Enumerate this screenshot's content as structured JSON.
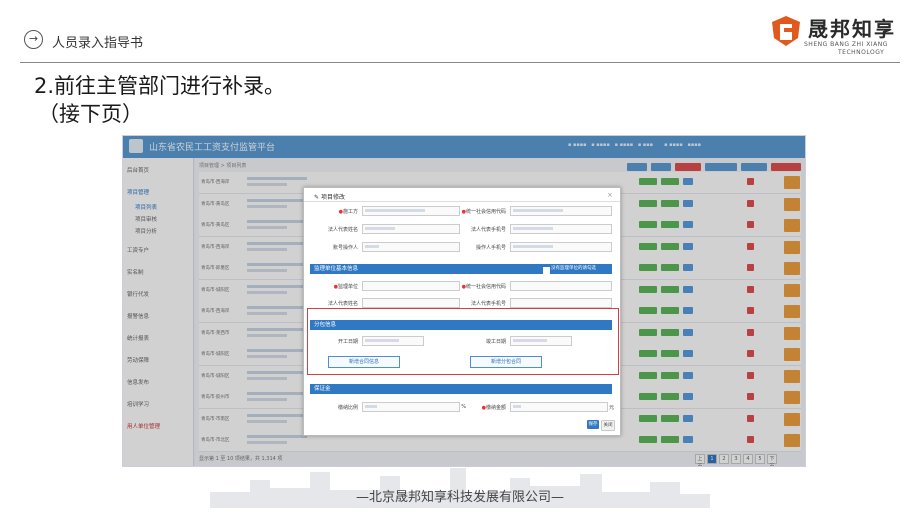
{
  "slide": {
    "header_title": "人员录入指导书",
    "heading": "2.前往主管部门进行补录。",
    "subheading": "（接下页）",
    "footer": "—北京晟邦知享科技发展有限公司—",
    "logo_cn": "晟邦知享",
    "logo_en_1": "SHENG BANG ZHI XIANG",
    "logo_en_2": "TECHNOLOGY"
  },
  "app": {
    "title": "山东省农民工工资支付监管平台",
    "breadcrumb": "项目管理 > 项目列表",
    "pager_text": "显示第 1 至 10 项结果，共 1,314 项",
    "pages": [
      "上页",
      "1",
      "2",
      "3",
      "4",
      "5",
      "下页"
    ]
  },
  "sidebar": {
    "items": [
      {
        "label": "后台首页"
      },
      {
        "label": "项目管理"
      },
      {
        "label": "项目列表"
      },
      {
        "label": "项目审核"
      },
      {
        "label": "项目分析"
      },
      {
        "label": "工资专户"
      },
      {
        "label": "实名制"
      },
      {
        "label": "银行代发"
      },
      {
        "label": "报警信息"
      },
      {
        "label": "统计报表"
      },
      {
        "label": "劳动保障"
      },
      {
        "label": "信息发布"
      },
      {
        "label": "培训学习"
      },
      {
        "label": "用人单位管理"
      }
    ]
  },
  "modal": {
    "title": "项目修改",
    "close": "×",
    "field_builder": "施工方",
    "field_credit": "统一社会信用代码",
    "field_legal_rep": "法人代表姓名",
    "field_legal_phone": "法人代表手机号",
    "field_account_mgr": "账号操作人",
    "field_operator_phone": "操作人手机号",
    "section_supervision": "监理单位基本信息",
    "no_supervision_check": "没有监理单位的请勾选",
    "field_supervisor": "监理单位",
    "field_sup_credit": "统一社会信用代码",
    "field_sup_legal": "法人代表姓名",
    "field_sup_phone": "法人代表手机号",
    "section_subcontract": "分包信息",
    "field_start": "开工日期",
    "field_end": "竣工日期",
    "btn_add_contract": "新增合同信息",
    "btn_add_subcontract": "新增分包合同",
    "section_deposit": "保证金",
    "field_deposit_ratio": "缴纳比例",
    "field_deposit_amount": "缴纳金额",
    "percent": "%",
    "yuan": "元",
    "btn_save": "保存",
    "btn_close": "关闭"
  },
  "rows": [
    {
      "region": "青岛市·西海岸"
    },
    {
      "region": "青岛市·黄岛区"
    },
    {
      "region": "青岛市·黄岛区"
    },
    {
      "region": "青岛市·西海岸"
    },
    {
      "region": "青岛市·即墨区"
    },
    {
      "region": "青岛市·城阳区"
    },
    {
      "region": "青岛市·西海岸"
    },
    {
      "region": "青岛市·莱西市"
    },
    {
      "region": "青岛市·城阳区"
    },
    {
      "region": "青岛市·城阳区"
    },
    {
      "region": "青岛市·胶州市"
    },
    {
      "region": "青岛市·市南区"
    },
    {
      "region": "青岛市·市北区"
    }
  ]
}
